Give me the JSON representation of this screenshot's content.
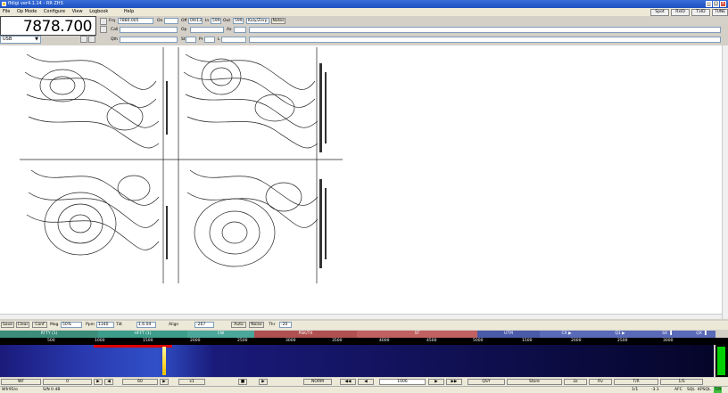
{
  "window": {
    "title": "fldigi ver4.1.14 - RR ZHS",
    "min": "_",
    "max": "□",
    "close": "x"
  },
  "menu": [
    "File",
    "Op Mode",
    "Configure",
    "View",
    "Logbook",
    "Help"
  ],
  "top_right_buttons": [
    "Spot",
    "RxID",
    "TxID",
    "TUNE"
  ],
  "freq": {
    "display": "7878.700",
    "mode": "USB"
  },
  "log": {
    "frq_label": "Frq",
    "frq_value": "7880.005",
    "on_label": "On",
    "off_label": "Off",
    "off_value": "09/13",
    "rst_label": "In",
    "rst_value": "599",
    "out_label": "Out",
    "out_value": "599",
    "notes_label": "Notes",
    "qth_label": "Qth",
    "call_label": "Call",
    "op_label": "Op",
    "az_label": "Az",
    "st_label": "St",
    "pr_label": "Pr",
    "l_label": "L",
    "qth_value": "Kaly/Zerp"
  },
  "ctrl": {
    "save": "Save",
    "clear": "Clear",
    "conf": "Conf",
    "mag_label": "Mag",
    "mag_value": "50%",
    "ppm_label": "Ppm",
    "ppm_value": "1340",
    "tilt_label": "Tilt",
    "tilt_value": "1.6.04",
    "align": "Align",
    "align_value": "-267",
    "auto": "Auto",
    "noise": "Noise",
    "thr_label": "Thr",
    "thr_value": "-20"
  },
  "bands": [
    {
      "label": "RTTY (1)",
      "color": "#3b8d7a"
    },
    {
      "label": "HFFT (1)",
      "color": "#3b9d8a"
    },
    {
      "label": "CW",
      "color": "#4aa79a"
    },
    {
      "label": "PSK/TX",
      "color": "#b05050"
    },
    {
      "label": "ST",
      "color": "#c06060"
    },
    {
      "label": "UTM",
      "color": "#4a5aa8"
    },
    {
      "label": "CX ▶",
      "color": "#5a6ab8"
    },
    {
      "label": "Q1 ▶",
      "color": "#5a6ab8"
    },
    {
      "label": "SX ▐",
      "color": "#5a6ab8"
    },
    {
      "label": "QX ▐",
      "color": "#5a6ab8"
    }
  ],
  "scale_ticks": [
    "500",
    "1000",
    "1500",
    "2000",
    "2500",
    "3000",
    "3500",
    "4000",
    "4500",
    "5000",
    "1500",
    "2000",
    "2500",
    "3000"
  ],
  "bottom": {
    "wf": "WF",
    "left_val": "0",
    "fr": "60",
    "x1": "x1",
    "norm": "NORM",
    "rate": "1006",
    "qsy": "QSY",
    "store": "Store",
    "lk": "Lk",
    "rv": "Rv",
    "tx": "T/R",
    "mon": "1/S"
  },
  "status": {
    "left": "Wfr95/o",
    "snr": "S/N 0 dB",
    "right": "1/1",
    "mode_r": "-3.1",
    "afc": "AFC",
    "sql": "SQL",
    "kpsql": "KPSQL",
    "txid": "T/R"
  }
}
